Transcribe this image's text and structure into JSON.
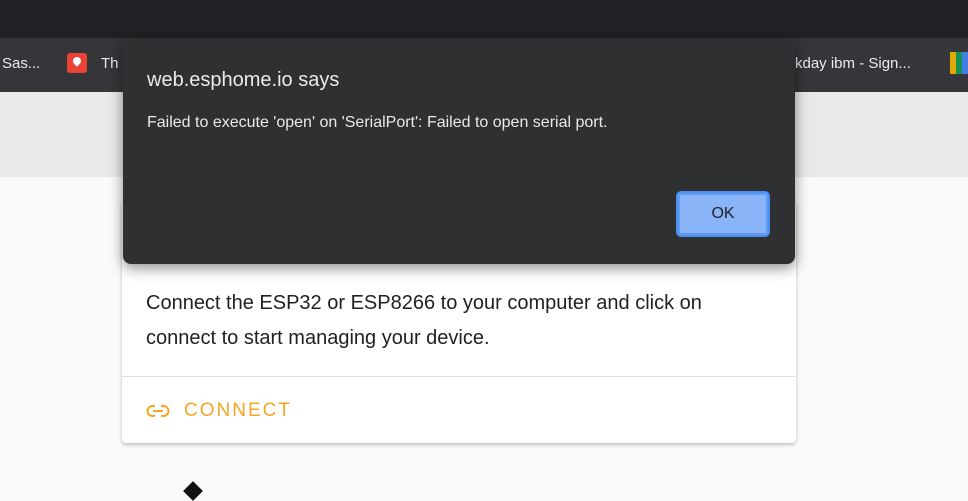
{
  "browser": {
    "bookmarks": {
      "item1": "Sas...",
      "item2": "Th",
      "item3": "kday ibm - Sign..."
    }
  },
  "card": {
    "description": "Connect the ESP32 or ESP8266 to your computer and click on connect to start managing your device.",
    "connect_label": "CONNECT",
    "connect_icon": "link-icon",
    "accent_color": "#f5a623"
  },
  "dialog": {
    "title": "web.esphome.io says",
    "message": "Failed to execute 'open' on 'SerialPort': Failed to open serial port.",
    "ok_label": "OK"
  }
}
